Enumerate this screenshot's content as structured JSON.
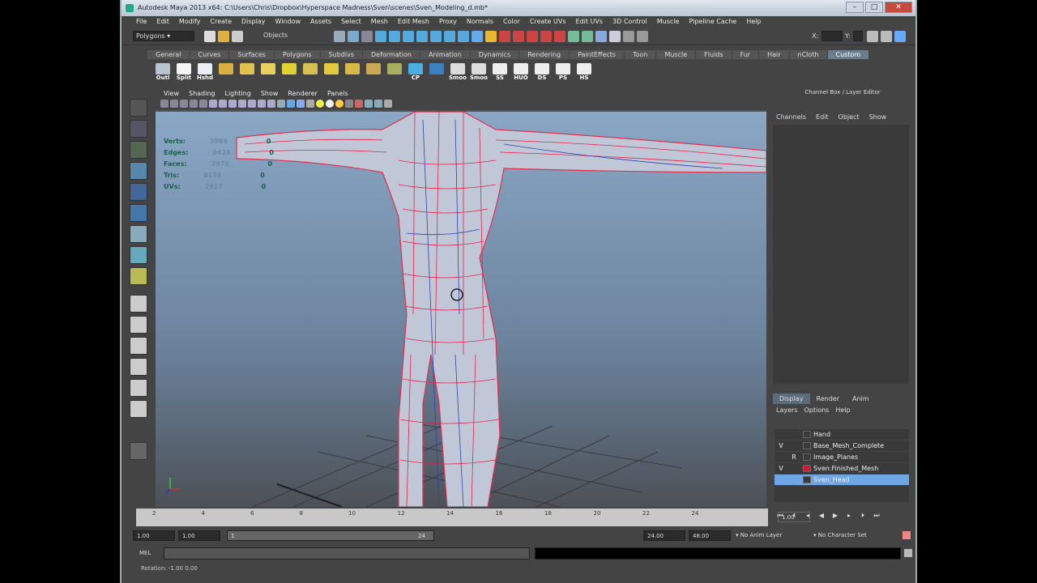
{
  "window": {
    "title": "Autodesk Maya 2013 x64: C:\\Users\\Chris\\Dropbox\\Hyperspace Madness\\Sven\\scenes\\Sven_Modeling_d.mb*",
    "min": "–",
    "max": "□",
    "close": "✕"
  },
  "menubar": [
    "File",
    "Edit",
    "Modify",
    "Create",
    "Display",
    "Window",
    "Assets",
    "Select",
    "Mesh",
    "Edit Mesh",
    "Proxy",
    "Normals",
    "Color",
    "Create UVs",
    "Edit UVs",
    "3D Control",
    "Muscle",
    "Pipeline Cache",
    "Help"
  ],
  "status": {
    "mode": "Polygons",
    "objects_label": "Objects",
    "x_label": "X:",
    "y_label": "Y:"
  },
  "shelf": {
    "tabs": [
      "General",
      "Curves",
      "Surfaces",
      "Polygons",
      "Subdivs",
      "Deformation",
      "Animation",
      "Dynamics",
      "Rendering",
      "PaintEffects",
      "Toon",
      "Muscle",
      "Fluids",
      "Fur",
      "Hair",
      "nCloth",
      "Custom"
    ],
    "active_tab": "Custom",
    "icons": [
      {
        "label": "Outl",
        "color": "#b8c4d0"
      },
      {
        "label": "Split",
        "color": "#f4f4f4"
      },
      {
        "label": "Hshd",
        "color": "#e8eef4"
      },
      {
        "label": "",
        "color": "#d8b040"
      },
      {
        "label": "",
        "color": "#e0c050"
      },
      {
        "label": "",
        "color": "#e8d060"
      },
      {
        "label": "",
        "color": "#e0d030"
      },
      {
        "label": "",
        "color": "#d8c050"
      },
      {
        "label": "",
        "color": "#e0c840"
      },
      {
        "label": "",
        "color": "#d8b848"
      },
      {
        "label": "",
        "color": "#c8a850"
      },
      {
        "label": "",
        "color": "#a8b060"
      },
      {
        "label": "CP",
        "color": "#4ab0e0"
      },
      {
        "label": "",
        "color": "#3a80c0"
      },
      {
        "label": "Smoo",
        "color": "#dcdcdc"
      },
      {
        "label": "Smoo",
        "color": "#dcdcdc"
      },
      {
        "label": "SS",
        "color": "#eeeeee"
      },
      {
        "label": "HUO",
        "color": "#eeeeee"
      },
      {
        "label": "DS",
        "color": "#eeeeee"
      },
      {
        "label": "PS",
        "color": "#eeeeee"
      },
      {
        "label": "HS",
        "color": "#eeeeee"
      }
    ]
  },
  "viewport": {
    "menu": [
      "View",
      "Shading",
      "Lighting",
      "Show",
      "Renderer",
      "Panels"
    ],
    "hud": [
      {
        "label": "Verts:",
        "value": "3988"
      },
      {
        "label": "Edges:",
        "value": "8424"
      },
      {
        "label": "Faces:",
        "value": "3976"
      },
      {
        "label": "Tris:",
        "value": "8174"
      },
      {
        "label": "UVs:",
        "value": "2917"
      }
    ],
    "hud_zero": "0"
  },
  "channel_box": {
    "title": "Channel Box / Layer Editor",
    "menu": [
      "Channels",
      "Edit",
      "Object",
      "Show"
    ],
    "layer_tabs": [
      "Display",
      "Render",
      "Anim"
    ],
    "active_layer_tab": "Display",
    "layer_menu": [
      "Layers",
      "Options",
      "Help"
    ],
    "layers": [
      {
        "v": "",
        "r": "",
        "name": "Hand",
        "color": "#3a3a3a",
        "selected": false
      },
      {
        "v": "V",
        "r": "",
        "name": "Base_Mesh_Complete",
        "color": "#3a3a3a",
        "selected": false
      },
      {
        "v": "",
        "r": "R",
        "name": "Image_Planes",
        "color": "#3a3a3a",
        "selected": false
      },
      {
        "v": "V",
        "r": "",
        "name": "Sven:Finished_Mesh",
        "color": "#e8102a",
        "selected": false
      },
      {
        "v": "",
        "r": "",
        "name": "Sven_Head",
        "color": "#3a3a3a",
        "selected": true
      }
    ]
  },
  "timeline": {
    "ticks": [
      "2",
      "4",
      "6",
      "8",
      "10",
      "12",
      "14",
      "16",
      "18",
      "20",
      "22",
      "24"
    ],
    "current": "1.00"
  },
  "range": {
    "start": "1.00",
    "start2": "1.00",
    "slider_start": "1",
    "slider_end": "24",
    "end": "24.00",
    "end2": "48.00",
    "anim_layer": "No Anim Layer",
    "char_set": "No Character Set"
  },
  "mel": {
    "label": "MEL"
  },
  "help": {
    "text": "Rotation:  -1.00   0.00"
  }
}
